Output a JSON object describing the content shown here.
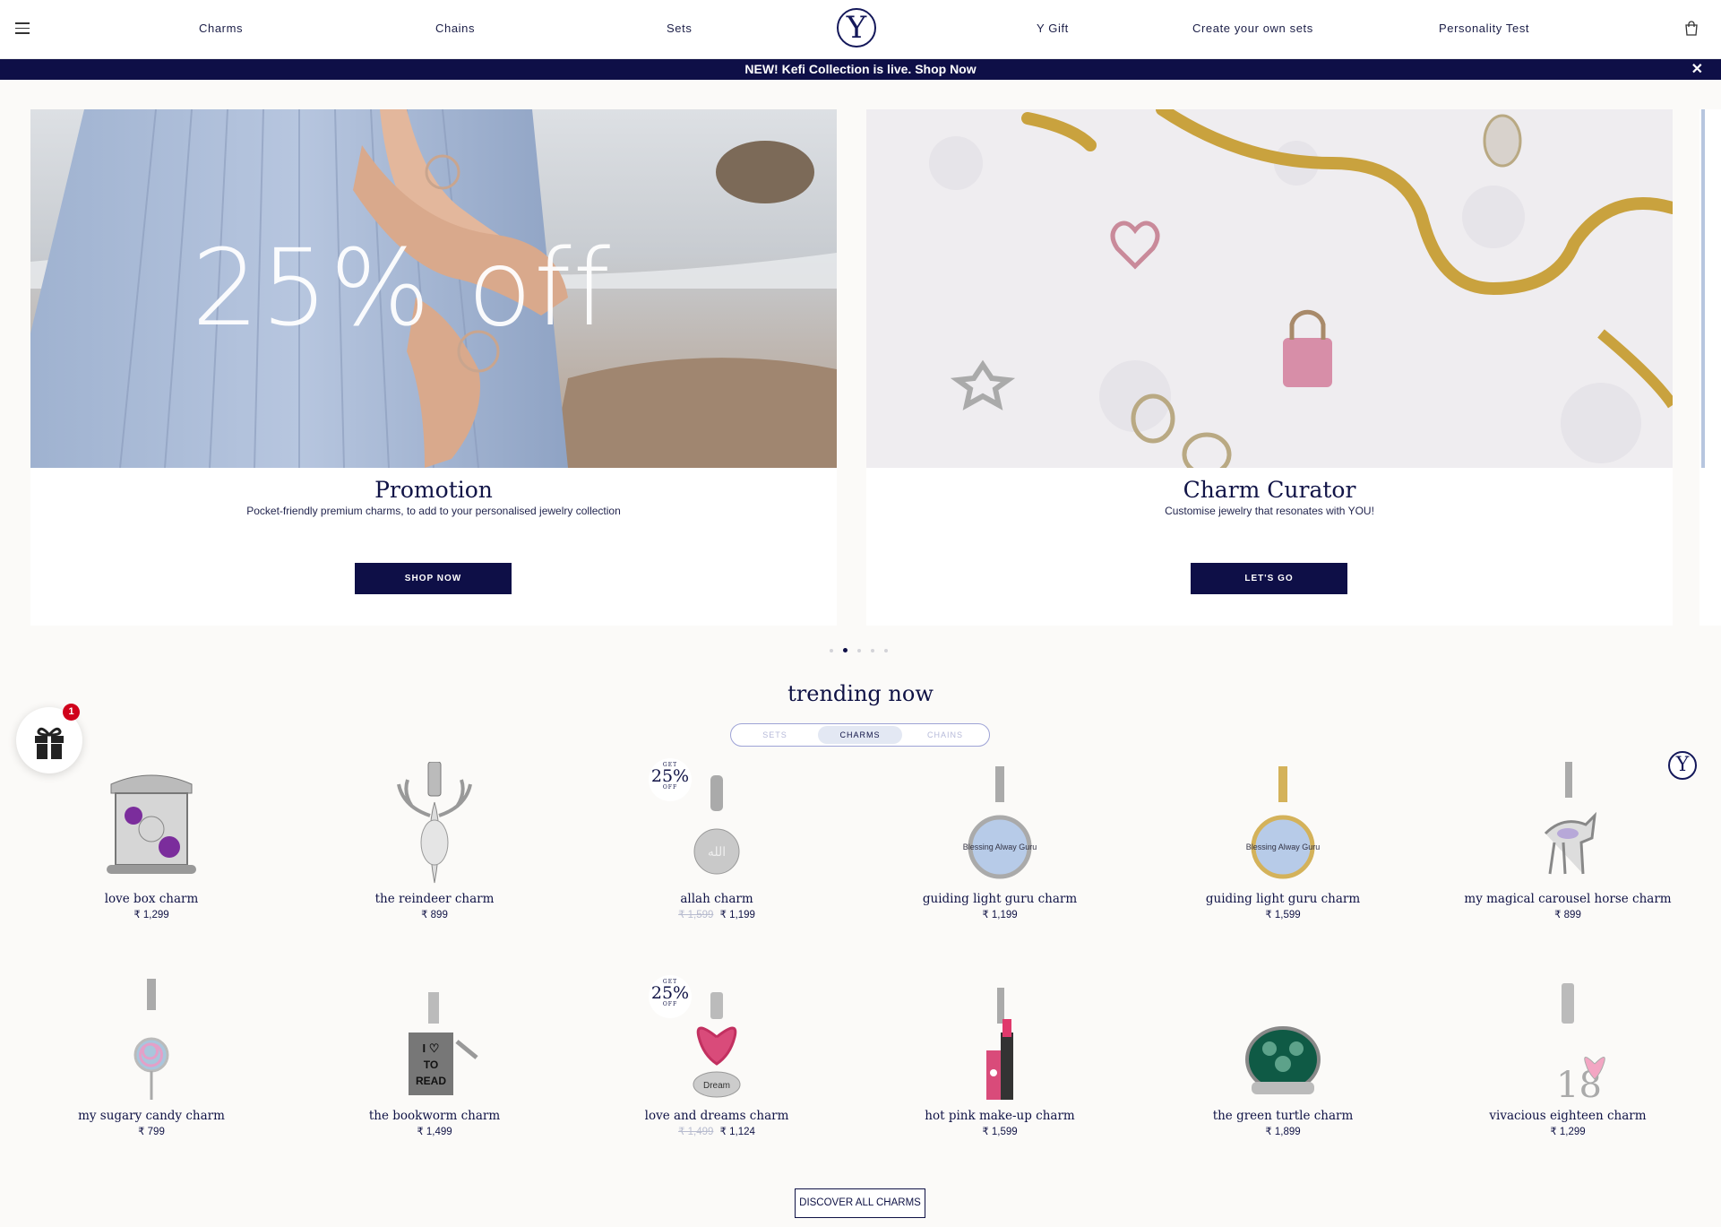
{
  "header": {
    "nav": [
      "Charms",
      "Chains",
      "Sets",
      "Y Gift",
      "Create your own sets",
      "Personality Test"
    ],
    "logo_letter": "Y"
  },
  "announcement": {
    "text": "NEW! Kefi Collection is live.",
    "link": "Shop Now",
    "close": "✕"
  },
  "carousel": {
    "slides": [
      {
        "overlay": "25% off",
        "title": "Promotion",
        "description": "Pocket-friendly premium charms, to add to your personalised jewelry collection",
        "button": "SHOP NOW"
      },
      {
        "overlay": "",
        "title": "Charm Curator",
        "description": "Customise jewelry that resonates with YOU!",
        "button": "LET'S GO"
      }
    ],
    "dot_count": 5,
    "active_dot": 1
  },
  "trending": {
    "title": "trending now",
    "tabs": [
      "SETS",
      "CHARMS",
      "CHAINS"
    ],
    "active_tab": "CHARMS",
    "badge": {
      "top": "GET",
      "mid": "25%",
      "bottom": "OFF"
    },
    "products": [
      {
        "name": "love box charm",
        "price": "₹ 1,299",
        "old_price": ""
      },
      {
        "name": "the reindeer charm",
        "price": "₹ 899",
        "old_price": ""
      },
      {
        "name": "allah charm",
        "price": "₹ 1,199",
        "old_price": "₹ 1,599"
      },
      {
        "name": "guiding light guru charm",
        "price": "₹ 1,199",
        "old_price": ""
      },
      {
        "name": "guiding light guru charm",
        "price": "₹ 1,599",
        "old_price": ""
      },
      {
        "name": "my magical carousel horse charm",
        "price": "₹ 899",
        "old_price": ""
      },
      {
        "name": "my sugary candy charm",
        "price": "₹ 799",
        "old_price": ""
      },
      {
        "name": "the bookworm charm",
        "price": "₹ 1,499",
        "old_price": ""
      },
      {
        "name": "love and dreams charm",
        "price": "₹ 1,124",
        "old_price": "₹ 1,499"
      },
      {
        "name": "hot pink make-up charm",
        "price": "₹ 1,599",
        "old_price": ""
      },
      {
        "name": "the green turtle charm",
        "price": "₹ 1,899",
        "old_price": ""
      },
      {
        "name": "vivacious eighteen charm",
        "price": "₹ 1,299",
        "old_price": ""
      }
    ],
    "discover_button": "DISCOVER ALL CHARMS"
  },
  "gift_widget": {
    "count": "1"
  },
  "product_art": {
    "bookworm_text": [
      "I ♡",
      "TO",
      "READ"
    ],
    "dream_text": "Dream",
    "eighteen_text": "18",
    "guru_text": "Blessing Alway Guru"
  },
  "colors": {
    "navy": "#0e0f47",
    "accent_pink": "#d94b7a",
    "purple_stone": "#7b2d9c",
    "turtle_green": "#0f5a45",
    "badge_red": "#d0021b"
  }
}
